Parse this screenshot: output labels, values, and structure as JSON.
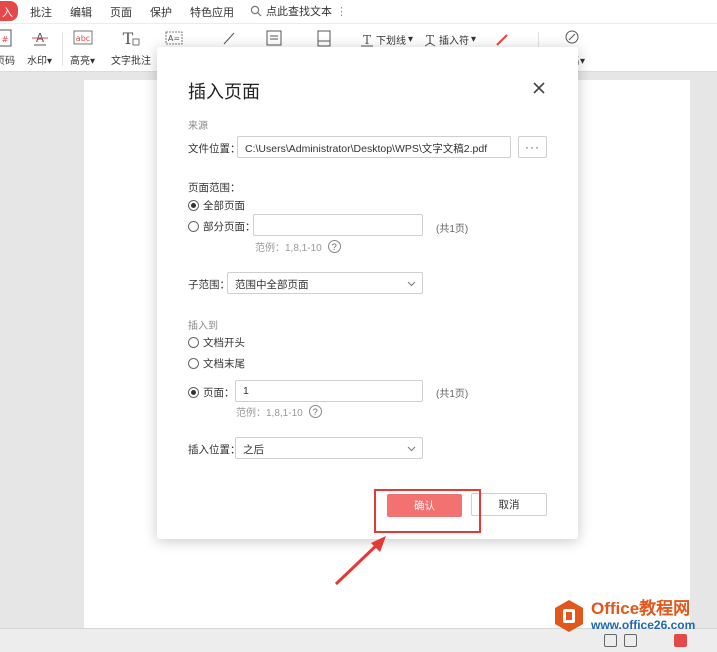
{
  "menu": {
    "active_tab": "入",
    "tabs": [
      "批注",
      "编辑",
      "页面",
      "保护",
      "特色应用"
    ],
    "search_label": "点此查找文本"
  },
  "toolbar": {
    "page_number_label": "页码",
    "watermark_label": "水印",
    "highlight_label": "高亮",
    "text_comment_label": "文字批注",
    "underline_label": "下划线",
    "insert_symbol_label": "插入符",
    "sign_label": "名"
  },
  "dialog": {
    "title": "插入页面",
    "source_section": "来源",
    "file_location_label": "文件位置：",
    "file_path": "C:\\Users\\Administrator\\Desktop\\WPS\\文字文稿2.pdf",
    "browse_label": "···",
    "page_range_label": "页面范围：",
    "all_pages_label": "全部页面",
    "partial_pages_label": "部分页面：",
    "partial_pages_value": "",
    "total_pages_1": "(共1页)",
    "example_hint_1": "范例：1,8,1-10",
    "subrange_label": "子范围：",
    "subrange_value": "范围中全部页面",
    "insert_to_section": "插入到",
    "doc_start_label": "文档开头",
    "doc_end_label": "文档末尾",
    "page_label": "页面：",
    "page_value": "1",
    "total_pages_2": "(共1页)",
    "example_hint_2": "范例：1,8,1-10",
    "insert_position_label": "插入位置：",
    "insert_position_value": "之后",
    "help_mark": "?",
    "confirm_label": "确认",
    "cancel_label": "取消",
    "selected_range": "all",
    "selected_insert": "page"
  },
  "watermark_logo": {
    "brand": "Office教程网",
    "site": "www.office26.com"
  },
  "colors": {
    "accent": "#e54848",
    "confirm_button": "#f27171",
    "annotation": "#e53935",
    "logo_orange": "#e2571b",
    "logo_blue": "#1f67b3"
  }
}
